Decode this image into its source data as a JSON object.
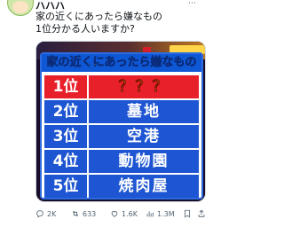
{
  "post": {
    "author_name": "ハハハ",
    "text_line1": "家の近くにあったら嫌なもの",
    "text_line2": "1位分かる人いますか?"
  },
  "image": {
    "board_title_prefix": "家の近くにあったら",
    "board_title_highlight": "嫌なもの",
    "rankings": [
      {
        "rank": "1位",
        "item": "？？？"
      },
      {
        "rank": "2位",
        "item": "墓地"
      },
      {
        "rank": "3位",
        "item": "空港"
      },
      {
        "rank": "4位",
        "item": "動物園"
      },
      {
        "rank": "5位",
        "item": "焼肉屋"
      }
    ]
  },
  "actions": {
    "replies": "2K",
    "reposts": "633",
    "likes": "1.6K",
    "views": "1.3M"
  },
  "icons": {
    "reply": "reply-icon",
    "repost": "repost-icon",
    "like": "like-icon",
    "views": "views-icon",
    "bookmark": "bookmark-icon",
    "share": "share-icon"
  },
  "colors": {
    "board_blue": "#1e55d2",
    "rank_red": "#e8202a",
    "question_yellow": "#ffe23a",
    "meta_gray": "#536471"
  }
}
